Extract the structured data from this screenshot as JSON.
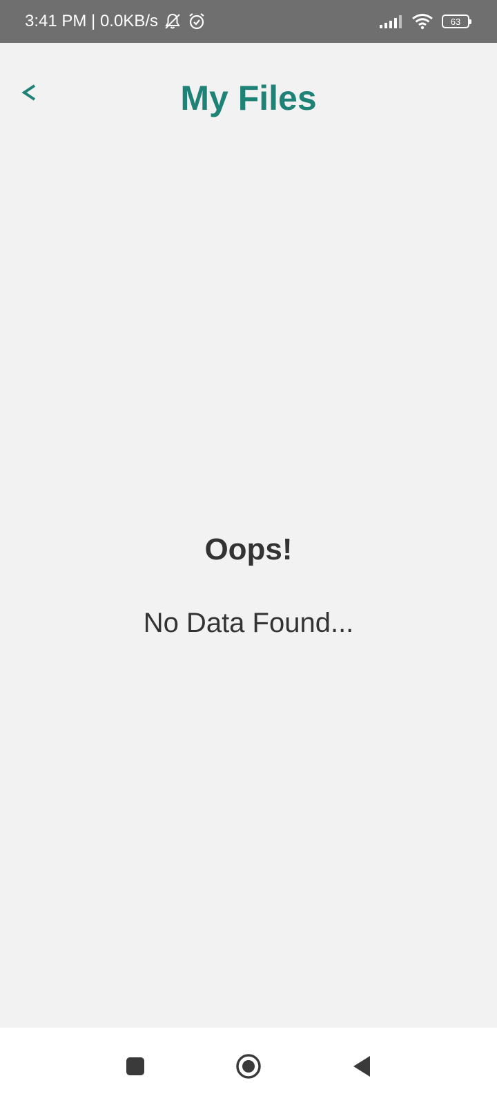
{
  "status_bar": {
    "time_text": "3:41 PM | 0.0KB/s",
    "battery_level": "63",
    "icons": [
      "notifications-muted-icon",
      "alarm-icon",
      "signal-icon",
      "wifi-icon",
      "battery-icon"
    ]
  },
  "header": {
    "back_label": "<",
    "title": "My Files"
  },
  "empty_state": {
    "title": "Oops!",
    "message": "No Data Found..."
  },
  "nav_bar": {
    "icons": [
      "recents-square-icon",
      "home-circle-icon",
      "back-triangle-icon"
    ]
  },
  "colors": {
    "accent": "#1f8276",
    "status_bar_bg": "#6f6f6f",
    "page_bg": "#f2f2f2",
    "text": "#333333"
  }
}
